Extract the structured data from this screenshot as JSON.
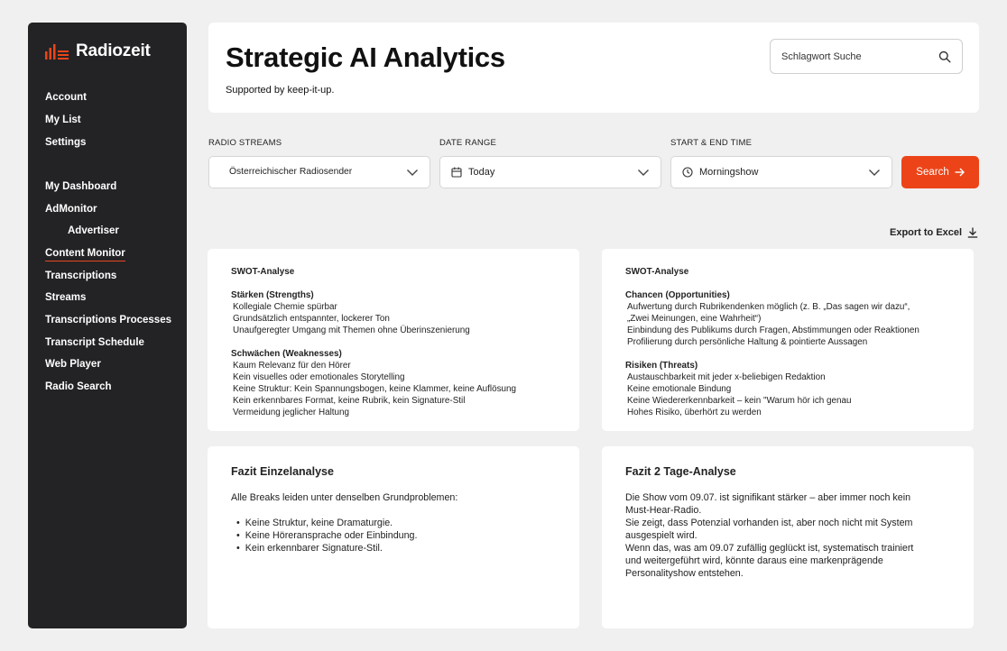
{
  "app": {
    "name": "Radiozeit",
    "brand_color": "#ec4418",
    "sidebar_bg": "#232326"
  },
  "sidebar": {
    "account_items": [
      {
        "label": "Account"
      },
      {
        "label": "My List"
      },
      {
        "label": "Settings"
      }
    ],
    "nav_items": [
      {
        "label": "My Dashboard"
      },
      {
        "label": "AdMonitor"
      },
      {
        "label": "Advertiser"
      },
      {
        "label": "Content Monitor"
      },
      {
        "label": "Transcriptions"
      },
      {
        "label": "Streams"
      },
      {
        "label": "Transcriptions Processes"
      },
      {
        "label": "Transcript Schedule"
      },
      {
        "label": "Web Player"
      },
      {
        "label": "Radio Search"
      }
    ],
    "active_item": "Content Monitor"
  },
  "header": {
    "title": "Strategic AI Analytics",
    "subtitle": "Supported by keep-it-up.",
    "search_placeholder": "Schlagwort Suche"
  },
  "filters": {
    "streams_label": "RADIO STREAMS",
    "streams_value": "Österreichischer Radiosender",
    "date_label": "DATE RANGE",
    "date_value": "Today",
    "time_label": "START & END TIME",
    "time_value": "Morningshow",
    "search_button": "Search"
  },
  "export_label": "Export to Excel",
  "swot_left": {
    "title": "SWOT-Analyse",
    "sections": [
      {
        "heading": "Stärken (Strengths)",
        "items": [
          "Kollegiale Chemie spürbar",
          "Grundsätzlich entspannter, lockerer Ton",
          "Unaufgeregter Umgang mit Themen ohne Überinszenierung"
        ]
      },
      {
        "heading": "Schwächen (Weaknesses)",
        "items": [
          "Kaum Relevanz für den Hörer",
          "Kein visuelles oder emotionales Storytelling",
          "Keine Struktur: Kein Spannungsbogen, keine Klammer, keine Auflösung",
          "Kein erkennbares Format, keine Rubrik, kein Signature-Stil",
          "Vermeidung jeglicher Haltung"
        ]
      }
    ]
  },
  "swot_right": {
    "title": "SWOT-Analyse",
    "sections": [
      {
        "heading": "Chancen (Opportunities)",
        "items": [
          "Aufwertung durch Rubrikendenken möglich (z. B. „Das sagen wir dazu“,",
          "„Zwei Meinungen, eine Wahrheit“)",
          "Einbindung des Publikums durch Fragen, Abstimmungen oder Reaktionen",
          "Profilierung durch persönliche Haltung & pointierte Aussagen"
        ]
      },
      {
        "heading": "Risiken (Threats)",
        "items": [
          "Austauschbarkeit mit jeder x-beliebigen Redaktion",
          "Keine emotionale Bindung",
          "Keine Wiedererkennbarkeit – kein \"Warum hör ich genau",
          "Hohes Risiko, überhört zu werden"
        ]
      }
    ]
  },
  "fazit_left": {
    "title": "Fazit Einzelanalyse",
    "intro": "Alle Breaks leiden unter denselben Grundproblemen:",
    "bullets": [
      "Keine Struktur, keine Dramaturgie.",
      "Keine Höreransprache oder Einbindung.",
      "Kein erkennbarer Signature-Stil."
    ]
  },
  "fazit_right": {
    "title": "Fazit 2 Tage-Analyse",
    "lines": [
      "Die Show vom 09.07. ist signifikant stärker – aber immer noch kein",
      "Must-Hear-Radio.",
      "Sie zeigt, dass Potenzial vorhanden ist, aber noch nicht mit System",
      "ausgespielt wird.",
      "Wenn das, was am 09.07 zufällig geglückt ist, systematisch trainiert",
      "und weitergeführt wird, könnte daraus eine markenprägende",
      "Personalityshow entstehen."
    ]
  }
}
